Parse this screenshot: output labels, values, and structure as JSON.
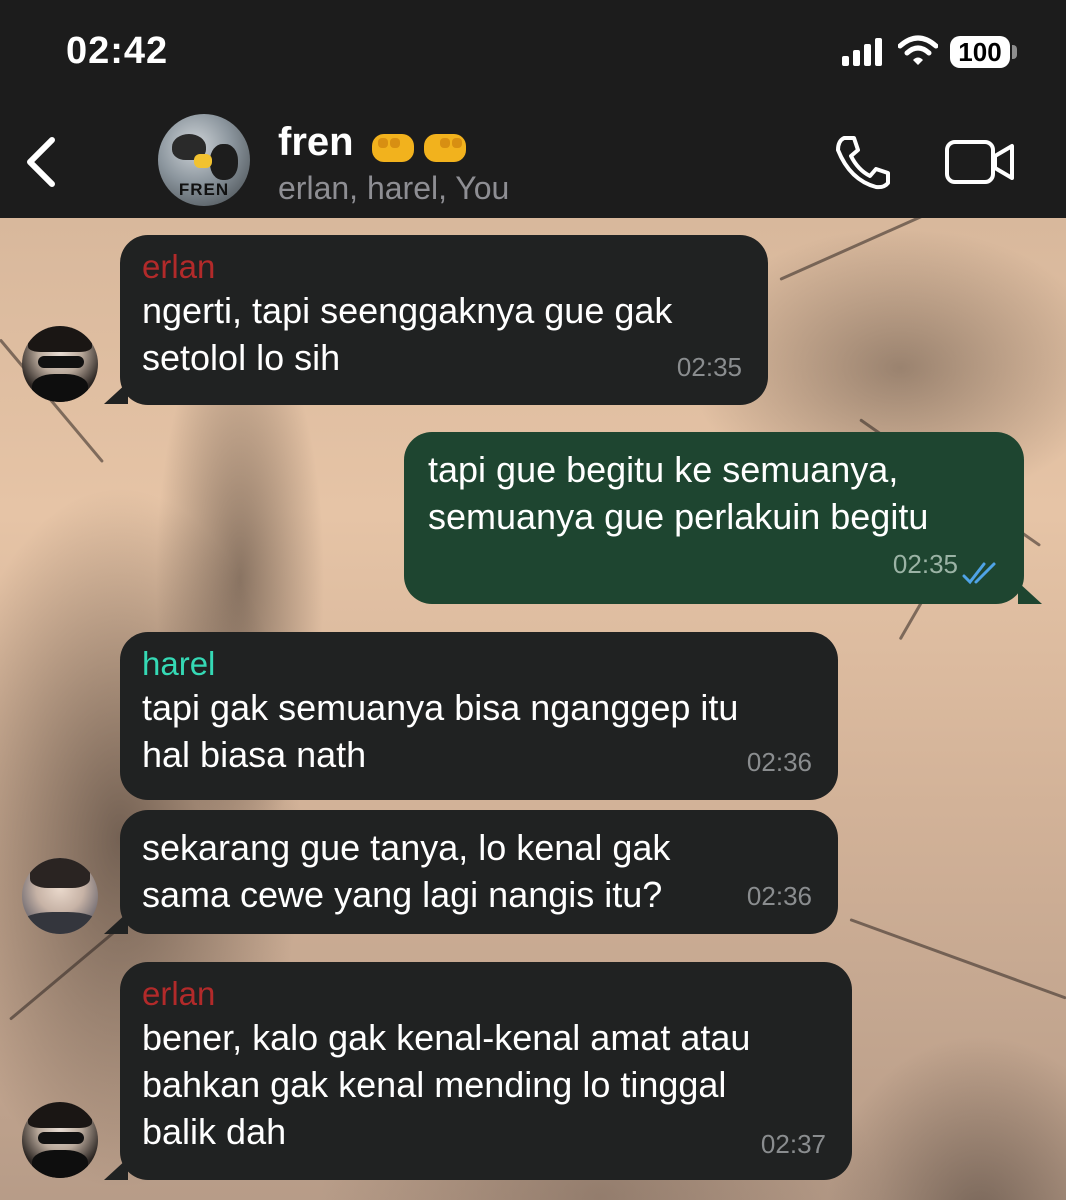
{
  "status_bar": {
    "time": "02:42",
    "battery": "100",
    "icons": [
      "signal-icon",
      "wifi-icon",
      "battery-icon"
    ]
  },
  "header": {
    "group_name": "fren",
    "group_emoji": "🤜🤛",
    "members": "erlan, harel, You",
    "avatar_label": "FREN",
    "icons": [
      "back-icon",
      "call-icon",
      "video-call-icon"
    ]
  },
  "colors": {
    "incoming_bubble": "#202222",
    "outgoing_bubble": "#1e4530",
    "erlan_name": "#b22a2a",
    "harel_name": "#35d9b5",
    "read_receipt": "#4fa3e6"
  },
  "messages": [
    {
      "sender": "erlan",
      "text": "ngerti, tapi seenggaknya gue gak\nsetolol lo sih",
      "time": "02:35"
    },
    {
      "sender": "You",
      "text": "tapi gue begitu ke semuanya,\nsemuanya gue perlakuin begitu",
      "time": "02:35",
      "status": "read"
    },
    {
      "sender": "harel",
      "text": "tapi gak semuanya bisa nganggep itu\nhal biasa nath",
      "time": "02:36"
    },
    {
      "sender": "harel",
      "text": "sekarang gue tanya, lo kenal gak\nsama cewe yang lagi nangis itu?",
      "time": "02:36"
    },
    {
      "sender": "erlan",
      "text": "bener, kalo gak kenal-kenal amat atau\nbahkan gak kenal mending lo tinggal\nbalik dah",
      "time": "02:37"
    }
  ]
}
